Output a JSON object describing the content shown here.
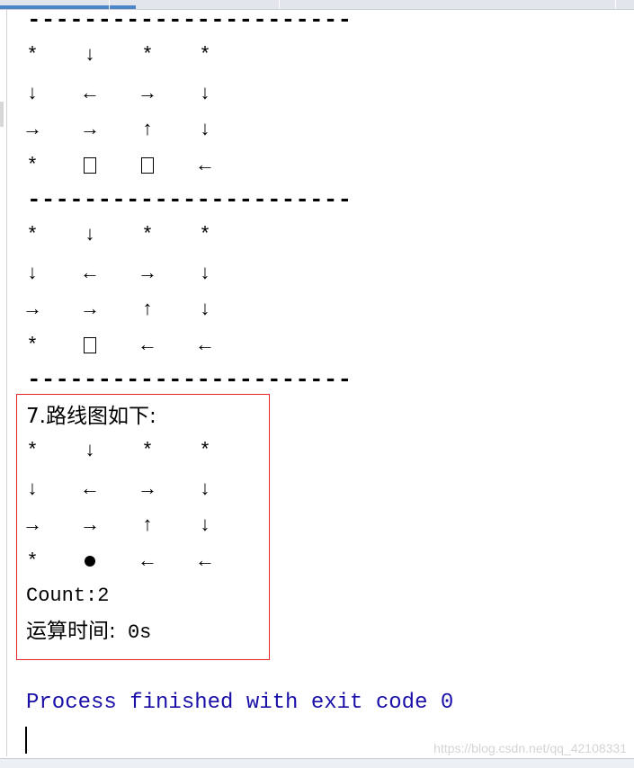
{
  "separator": "-----------------------",
  "grids": [
    [
      [
        "*",
        "↓",
        "*",
        "*"
      ],
      [
        "↓",
        "←",
        "→",
        "↓"
      ],
      [
        "→",
        "→",
        "↑",
        "↓"
      ],
      [
        "*",
        "□",
        "□",
        "←"
      ]
    ],
    [
      [
        "*",
        "↓",
        "*",
        "*"
      ],
      [
        "↓",
        "←",
        "→",
        "↓"
      ],
      [
        "→",
        "→",
        "↑",
        "↓"
      ],
      [
        "*",
        "□",
        "←",
        "←"
      ]
    ],
    [
      [
        "*",
        "↓",
        "*",
        "*"
      ],
      [
        "↓",
        "←",
        "→",
        "↓"
      ],
      [
        "→",
        "→",
        "↑",
        "↓"
      ],
      [
        "*",
        "●",
        "←",
        "←"
      ]
    ]
  ],
  "result": {
    "title": "7.路线图如下:",
    "count": "Count:2",
    "time_label": "运算时间:",
    "time_value": " 0s"
  },
  "process_message": "Process finished with exit code 0",
  "watermark": "https://blog.csdn.net/qq_42108331",
  "colors": {
    "highlight_border": "#e8262a",
    "process_text": "#1a10a8",
    "active_tab": "#4a86c8"
  }
}
